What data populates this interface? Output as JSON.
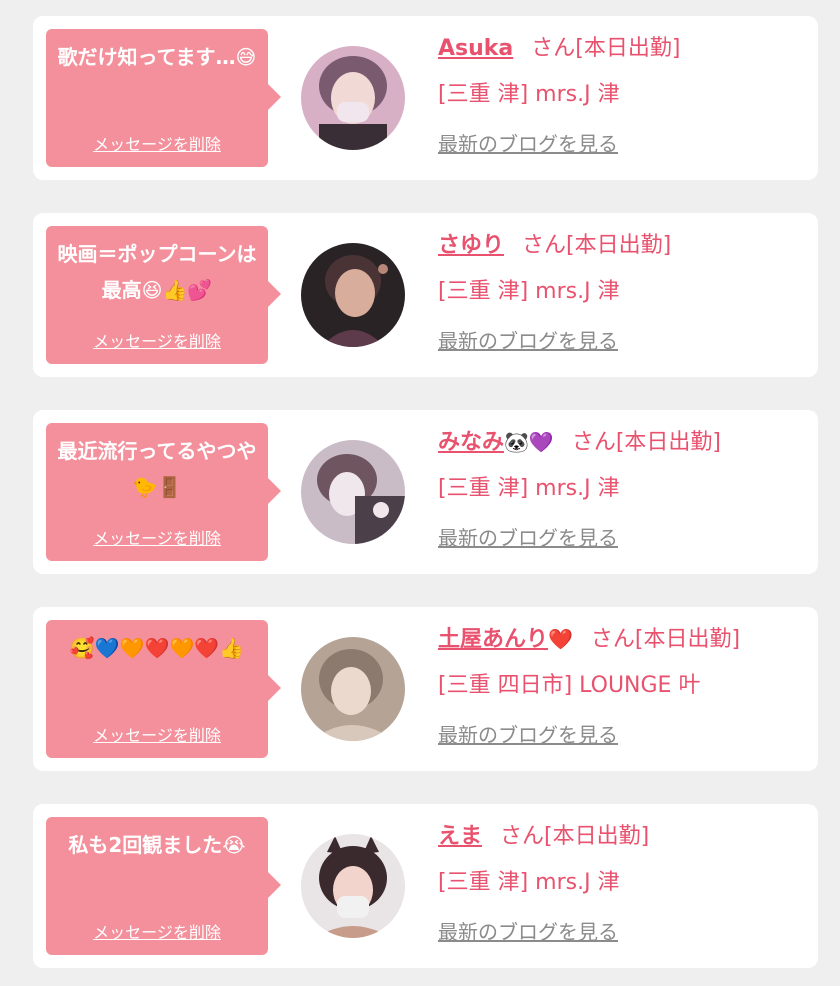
{
  "messages": [
    {
      "message": "歌だけ知ってます…😅",
      "delete_label": "メッセージを削除",
      "name": "Asuka",
      "name_emoji": "",
      "status": "さん[本日出勤]",
      "location": "[三重 津] mrs.J 津",
      "blog_link": "最新のブログを見る",
      "avatar_colors": [
        "#d7b0c6",
        "#7a5a6e",
        "#f2e6ee"
      ]
    },
    {
      "message": "映画＝ポップコーンは最高😆👍💕",
      "delete_label": "メッセージを削除",
      "name": "さゆり",
      "name_emoji": "",
      "status": "さん[本日出勤]",
      "location": "[三重 津] mrs.J 津",
      "blog_link": "最新のブログを見る",
      "avatar_colors": [
        "#2a2326",
        "#b9867a",
        "#5e3b4a"
      ]
    },
    {
      "message": "最近流行ってるやつや🐤🚪",
      "delete_label": "メッセージを削除",
      "name": "みなみ",
      "name_emoji": "🐼💜",
      "status": "さん[本日出勤]",
      "location": "[三重 津] mrs.J 津",
      "blog_link": "最新のブログを見る",
      "avatar_colors": [
        "#c9bcc6",
        "#4b3f4a",
        "#efe7ec"
      ]
    },
    {
      "message": "🥰💙🧡❤️🧡❤️👍",
      "delete_label": "メッセージを削除",
      "name": "土屋あんり",
      "name_emoji": "❤️",
      "status": "さん[本日出勤]",
      "location": "[三重 四日市] LOUNGE 叶",
      "blog_link": "最新のブログを見る",
      "avatar_colors": [
        "#b5a396",
        "#d8c7bb",
        "#8c7a6e"
      ]
    },
    {
      "message": "私も2回観ました😭",
      "delete_label": "メッセージを削除",
      "name": "えま",
      "name_emoji": "",
      "status": "さん[本日出勤]",
      "location": "[三重 津] mrs.J 津",
      "blog_link": "最新のブログを見る",
      "avatar_colors": [
        "#3a2a2e",
        "#c79c8a",
        "#f1f1f1"
      ]
    }
  ],
  "colors": {
    "background": "#efefef",
    "bubble": "#f4909c",
    "accent": "#e8526e",
    "link_gray": "#8b8b8b"
  }
}
